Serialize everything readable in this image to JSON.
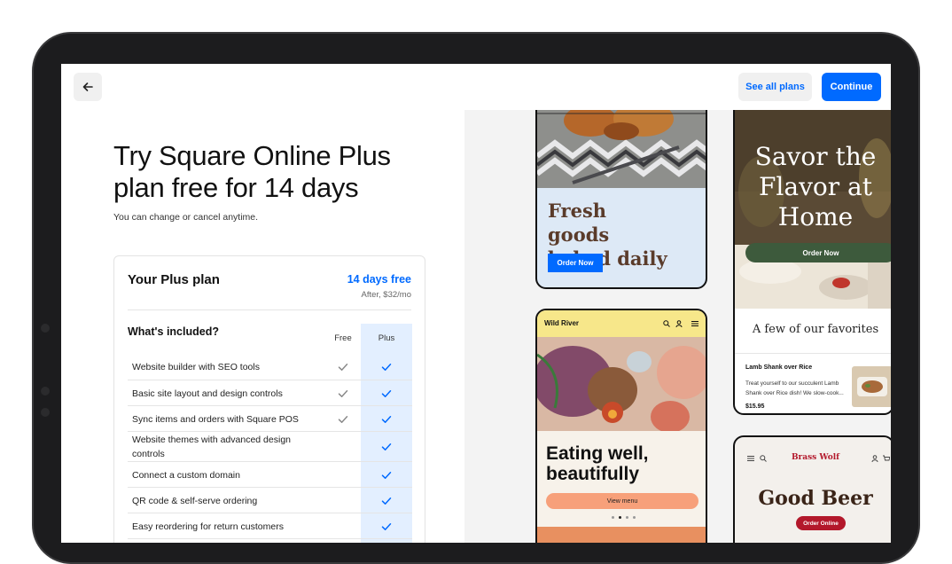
{
  "topbar": {
    "back_icon": "arrow-left-icon",
    "see_all_plans": "See all plans",
    "continue": "Continue"
  },
  "hero": {
    "headline": "Try Square Online Plus plan free for 14 days",
    "subtext": "You can change or cancel anytime."
  },
  "plan": {
    "title": "Your Plus plan",
    "trial": "14 days free",
    "after": "After, $32/mo",
    "included_heading": "What's included?",
    "col_free": "Free",
    "col_plus": "Plus",
    "features": [
      {
        "label": "Website builder with SEO tools",
        "free": true,
        "plus": true
      },
      {
        "label": "Basic site layout and design controls",
        "free": true,
        "plus": true
      },
      {
        "label": "Sync items and orders with Square POS",
        "free": true,
        "plus": true
      },
      {
        "label": "Website themes with advanced design controls",
        "free": false,
        "plus": true
      },
      {
        "label": "Connect a custom domain",
        "free": false,
        "plus": true
      },
      {
        "label": "QR code & self-serve ordering",
        "free": false,
        "plus": true
      },
      {
        "label": "Easy reordering for return customers",
        "free": false,
        "plus": true
      }
    ]
  },
  "previews": {
    "bakery": {
      "heading": "Fresh goods baked daily",
      "button": "Order Now"
    },
    "savor": {
      "heading": "Savor the Flavor at Home",
      "button": "Order Now",
      "favorites": "A few of our favorites",
      "item_name": "Lamb Shank over Rice",
      "item_desc": "Treat yourself to our succulent Lamb Shank over Rice dish! We slow-cook...",
      "item_price": "$15.95"
    },
    "wild_river": {
      "brand": "Wild River",
      "heading": "Eating well, beautifully",
      "button": "View menu"
    },
    "brass_wolf": {
      "brand": "Brass Wolf",
      "heading": "Good Beer",
      "button": "Order Online"
    }
  },
  "colors": {
    "accent": "#006aff",
    "plus_column": "#e3efff",
    "savor_green": "#3d5a3c",
    "wild_river_yellow": "#f7e78a",
    "wild_river_button": "#f7a07a",
    "brass_wolf_red": "#b3182b"
  }
}
